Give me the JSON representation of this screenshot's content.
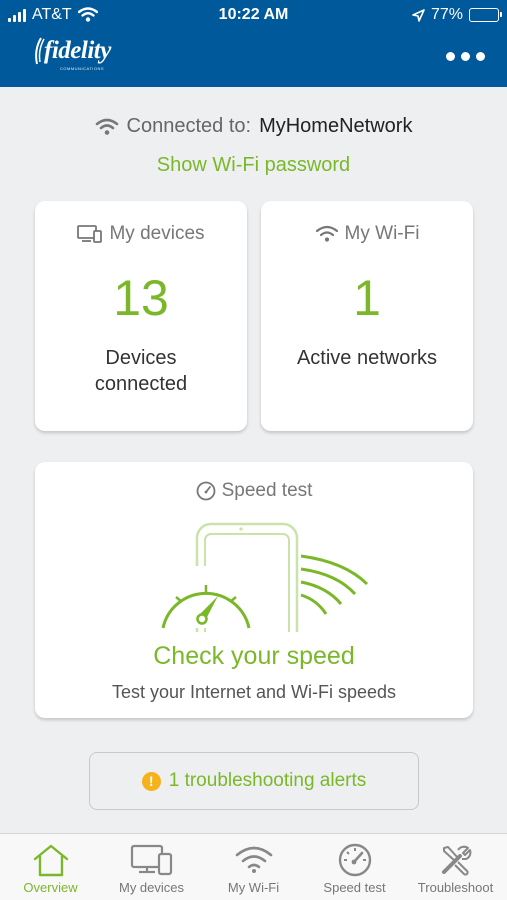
{
  "status_bar": {
    "carrier": "AT&T",
    "time": "10:22 AM",
    "battery": "77%",
    "battery_level": 0.77
  },
  "header": {
    "logo_text": "fidelity",
    "logo_tagline": "COMMUNICATIONS",
    "menu_icon": "more-dots-icon"
  },
  "connection": {
    "label": "Connected to:",
    "network_name": "MyHomeNetwork",
    "show_password_link": "Show Wi-Fi password"
  },
  "cards": {
    "devices": {
      "title": "My devices",
      "count": "13",
      "subtitle_line1": "Devices",
      "subtitle_line2": "connected",
      "icon": "devices-icon"
    },
    "wifi": {
      "title": "My Wi-Fi",
      "count": "1",
      "subtitle": "Active networks",
      "icon": "wifi-icon"
    },
    "speed": {
      "title": "Speed test",
      "cta": "Check your speed",
      "description": "Test your Internet and Wi-Fi speeds",
      "icon": "speedometer-icon"
    }
  },
  "alerts": {
    "label": "1 troubleshooting alerts",
    "icon_glyph": "!"
  },
  "tabs": [
    {
      "label": "Overview",
      "icon": "home-icon",
      "active": true
    },
    {
      "label": "My devices",
      "icon": "devices-icon",
      "active": false
    },
    {
      "label": "My Wi-Fi",
      "icon": "wifi-icon",
      "active": false
    },
    {
      "label": "Speed test",
      "icon": "speedometer-icon",
      "active": false
    },
    {
      "label": "Troubleshoot",
      "icon": "tools-icon",
      "active": false
    }
  ],
  "colors": {
    "header_blue": "#00599a",
    "accent_green": "#7ab829",
    "warning_amber": "#f5b21b",
    "background": "#eeeff1"
  }
}
